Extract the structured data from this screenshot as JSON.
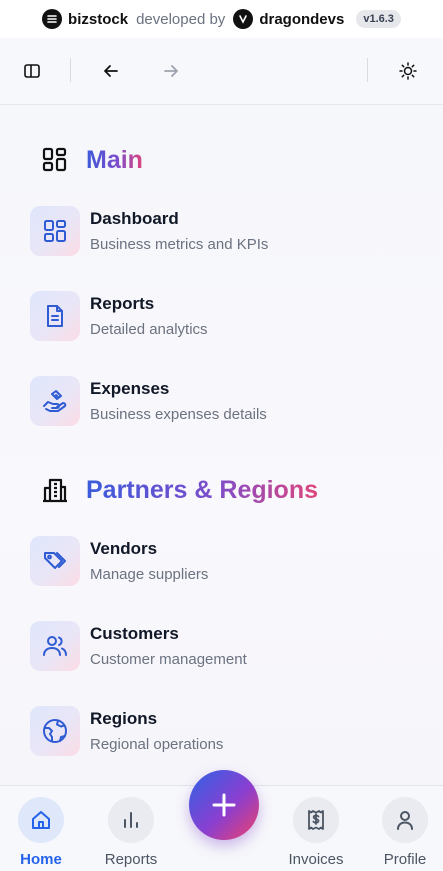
{
  "brand": {
    "name": "bizstock",
    "developed_by": "developed by",
    "developer": "dragondevs",
    "version": "v1.6.3"
  },
  "toolbar": {
    "buttons": [
      "sidebar-toggle-icon",
      "arrow-left-icon",
      "arrow-right-icon",
      "sun-icon"
    ]
  },
  "sections": [
    {
      "title": "Main",
      "icon": "grid-icon",
      "items": [
        {
          "label": "Dashboard",
          "description": "Business metrics and KPIs",
          "icon": "dashboard-icon"
        },
        {
          "label": "Reports",
          "description": "Detailed analytics",
          "icon": "document-icon"
        },
        {
          "label": "Expenses",
          "description": "Business expenses details",
          "icon": "hand-coins-icon"
        }
      ]
    },
    {
      "title": "Partners & Regions",
      "icon": "building-icon",
      "items": [
        {
          "label": "Vendors",
          "description": "Manage suppliers",
          "icon": "tags-icon"
        },
        {
          "label": "Customers",
          "description": "Customer management",
          "icon": "users-icon"
        },
        {
          "label": "Regions",
          "description": "Regional operations",
          "icon": "globe-icon"
        }
      ]
    }
  ],
  "bottom_nav": {
    "items": [
      {
        "label": "Home",
        "icon": "home-icon",
        "active": true
      },
      {
        "label": "Reports",
        "icon": "bar-chart-icon",
        "active": false
      },
      {
        "label": "Invoices",
        "icon": "receipt-icon",
        "active": false
      },
      {
        "label": "Profile",
        "icon": "user-icon",
        "active": false
      }
    ],
    "fab_icon": "plus-icon"
  },
  "colors": {
    "accent_blue": "#2563eb",
    "gradient_start": "#3b5bdb",
    "gradient_end": "#e0457b",
    "icon_blue": "#2f5bd3"
  }
}
